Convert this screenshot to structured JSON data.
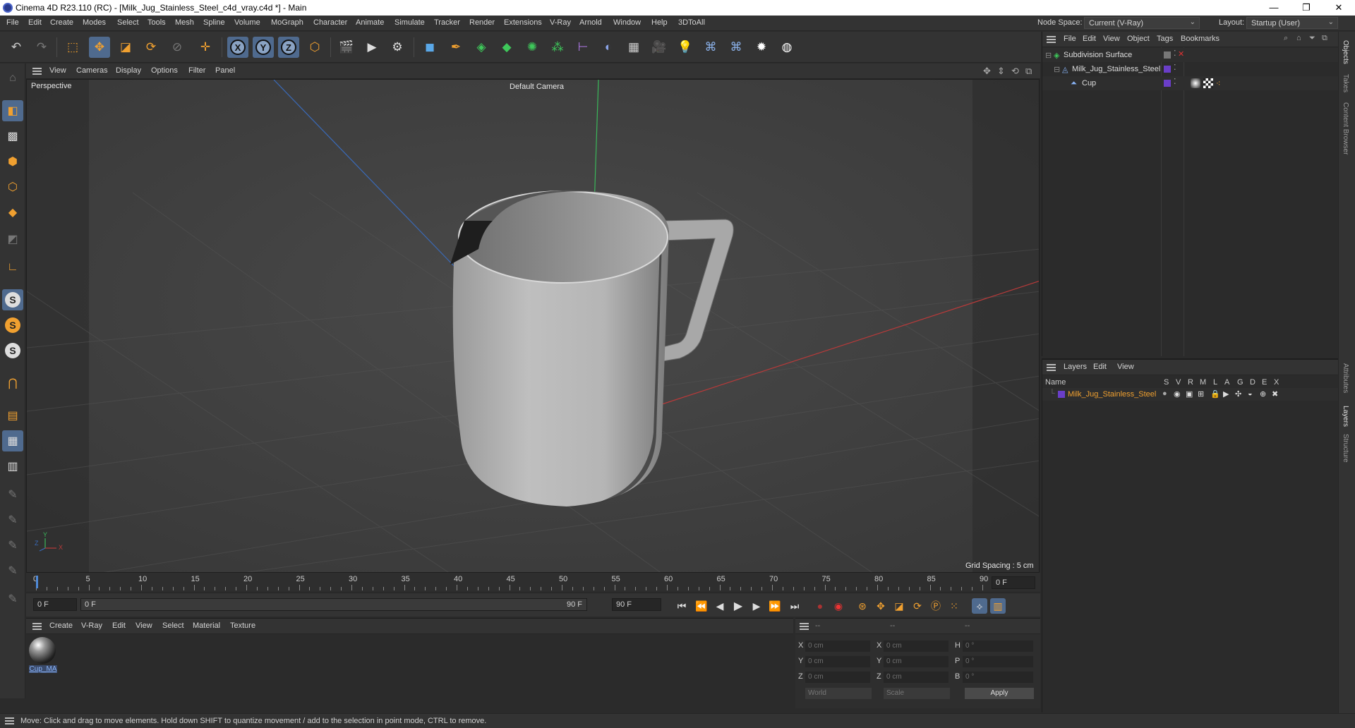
{
  "window": {
    "title": "Cinema 4D R23.110 (RC) - [Milk_Jug_Stainless_Steel_c4d_vray.c4d *] - Main",
    "minimize": "—",
    "maximize": "❐",
    "close": "✕"
  },
  "menubar": {
    "items": [
      "File",
      "Edit",
      "Create",
      "Modes",
      "Select",
      "Tools",
      "Mesh",
      "Spline",
      "Volume",
      "MoGraph",
      "Character",
      "Animate",
      "Simulate",
      "Tracker",
      "Render",
      "Extensions",
      "V-Ray",
      "Arnold",
      "Window",
      "Help",
      "3DToAll"
    ],
    "node_space_label": "Node Space:",
    "node_space_value": "Current (V-Ray)",
    "layout_label": "Layout:",
    "layout_value": "Startup (User)"
  },
  "toolbar": {
    "axis_x": "X",
    "axis_y": "Y",
    "axis_z": "Z"
  },
  "viewport": {
    "menu": [
      "View",
      "Cameras",
      "Display",
      "Options",
      "Filter",
      "Panel"
    ],
    "view_name": "Perspective",
    "camera": "Default Camera",
    "grid_spacing": "Grid Spacing : 5 cm",
    "axis_labels": {
      "y": "Y",
      "z": "Z",
      "x": "X"
    }
  },
  "timeline": {
    "ticks": [
      "0",
      "5",
      "10",
      "15",
      "20",
      "25",
      "30",
      "35",
      "40",
      "45",
      "50",
      "55",
      "60",
      "65",
      "70",
      "75",
      "80",
      "85",
      "90"
    ],
    "current_frame": "0 F",
    "start": "0 F",
    "range_start": "0 F",
    "range_end": "90 F",
    "end": "90 F"
  },
  "material_manager": {
    "menu": [
      "Create",
      "V-Ray",
      "Edit",
      "View",
      "Select",
      "Material",
      "Texture"
    ],
    "materials": [
      {
        "name": "Cup_MA"
      }
    ]
  },
  "coordinates": {
    "headers": [
      "--",
      "--",
      "--"
    ],
    "rows": [
      {
        "axis": "X",
        "pos": "0 cm",
        "axis2": "X",
        "size": "0 cm",
        "axis3": "H",
        "rot": "0 °"
      },
      {
        "axis": "Y",
        "pos": "0 cm",
        "axis2": "Y",
        "size": "0 cm",
        "axis3": "P",
        "rot": "0 °"
      },
      {
        "axis": "Z",
        "pos": "0 cm",
        "axis2": "Z",
        "size": "0 cm",
        "axis3": "B",
        "rot": "0 °"
      }
    ],
    "space": "World",
    "mode": "Scale",
    "apply": "Apply"
  },
  "status": {
    "text": "Move: Click and drag to move elements. Hold down SHIFT to quantize movement / add to the selection in point mode, CTRL to remove."
  },
  "object_manager": {
    "menu": [
      "File",
      "Edit",
      "View",
      "Object",
      "Tags",
      "Bookmarks"
    ],
    "objects": [
      {
        "name": "Subdivision Surface",
        "indent": 0
      },
      {
        "name": "Milk_Jug_Stainless_Steel",
        "indent": 1
      },
      {
        "name": "Cup",
        "indent": 2
      }
    ]
  },
  "layer_manager": {
    "menu": [
      "Layers",
      "Edit",
      "View"
    ],
    "columns": [
      "Name",
      "S",
      "V",
      "R",
      "M",
      "L",
      "A",
      "G",
      "D",
      "E",
      "X"
    ],
    "layers": [
      {
        "name": "Milk_Jug_Stainless_Steel",
        "color": "#6a3ec8"
      }
    ]
  },
  "right_tabs": [
    "Objects",
    "Takes",
    "Content Browser",
    "Attributes",
    "Layers",
    "Structure"
  ],
  "colors": {
    "accent": "#4f6a8e",
    "layer_name": "#f0a030",
    "x_axis": "#b83a3a",
    "y_axis": "#3ab85a",
    "z_axis": "#3a6ab8"
  }
}
